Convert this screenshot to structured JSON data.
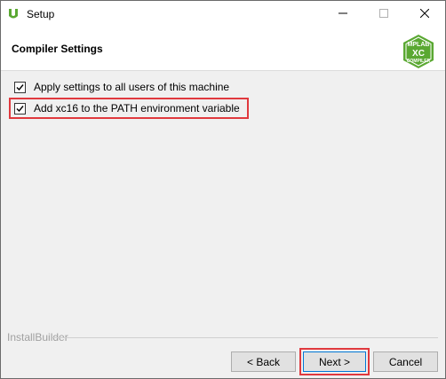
{
  "window": {
    "title": "Setup"
  },
  "header": {
    "page_title": "Compiler Settings",
    "logo_top": "MPLAB",
    "logo_mid": "XC",
    "logo_bottom": "COMPILER"
  },
  "options": [
    {
      "label": "Apply settings to all users of this machine",
      "checked": true
    },
    {
      "label": "Add xc16 to the PATH environment variable",
      "checked": true
    }
  ],
  "footer": {
    "brand": "InstallBuilder",
    "back_label": "< Back",
    "next_label": "Next >",
    "cancel_label": "Cancel"
  },
  "icons": {
    "app": "microchip-icon",
    "minimize": "minimize-icon",
    "maximize": "maximize-icon",
    "close": "close-icon",
    "check": "check-icon"
  },
  "colors": {
    "highlight": "#e0393e",
    "logo_green": "#5aa832",
    "default_button_border": "#0078d7"
  }
}
